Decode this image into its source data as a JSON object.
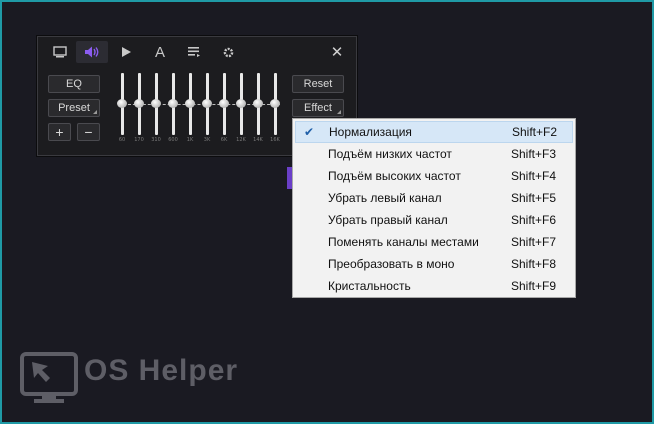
{
  "player": {
    "tabs": [
      {
        "icon": "monitor-icon"
      },
      {
        "icon": "speaker-icon",
        "active": true
      },
      {
        "icon": "play-icon"
      },
      {
        "icon": "text-icon",
        "glyph": "A"
      },
      {
        "icon": "playlist-icon"
      },
      {
        "icon": "gear-icon"
      }
    ],
    "close_glyph": "✕",
    "buttons": {
      "eq": "EQ",
      "preset": "Preset",
      "plus": "+",
      "minus": "−",
      "reset": "Reset",
      "effect": "Effect"
    },
    "eq_bands": [
      "60",
      "170",
      "310",
      "600",
      "1K",
      "3K",
      "6K",
      "12K",
      "14K",
      "16K"
    ]
  },
  "menu": {
    "items": [
      {
        "label": "Нормализация",
        "shortcut": "Shift+F2",
        "checked": true
      },
      {
        "label": "Подъём низких частот",
        "shortcut": "Shift+F3",
        "checked": false
      },
      {
        "label": "Подъём высоких частот",
        "shortcut": "Shift+F4",
        "checked": false
      },
      {
        "label": "Убрать левый канал",
        "shortcut": "Shift+F5",
        "checked": false
      },
      {
        "label": "Убрать правый канал",
        "shortcut": "Shift+F6",
        "checked": false
      },
      {
        "label": "Поменять каналы местами",
        "shortcut": "Shift+F7",
        "checked": false
      },
      {
        "label": "Преобразовать в моно",
        "shortcut": "Shift+F8",
        "checked": false
      },
      {
        "label": "Кристальность",
        "shortcut": "Shift+F9",
        "checked": false
      }
    ],
    "check_glyph": "✔"
  },
  "watermark": {
    "text": "OS Helper",
    "icon": "monitor-cursor-icon"
  },
  "colors": {
    "accent": "#7b4fe0",
    "border": "#1f9aa6",
    "highlight": "#d6e7f7"
  }
}
